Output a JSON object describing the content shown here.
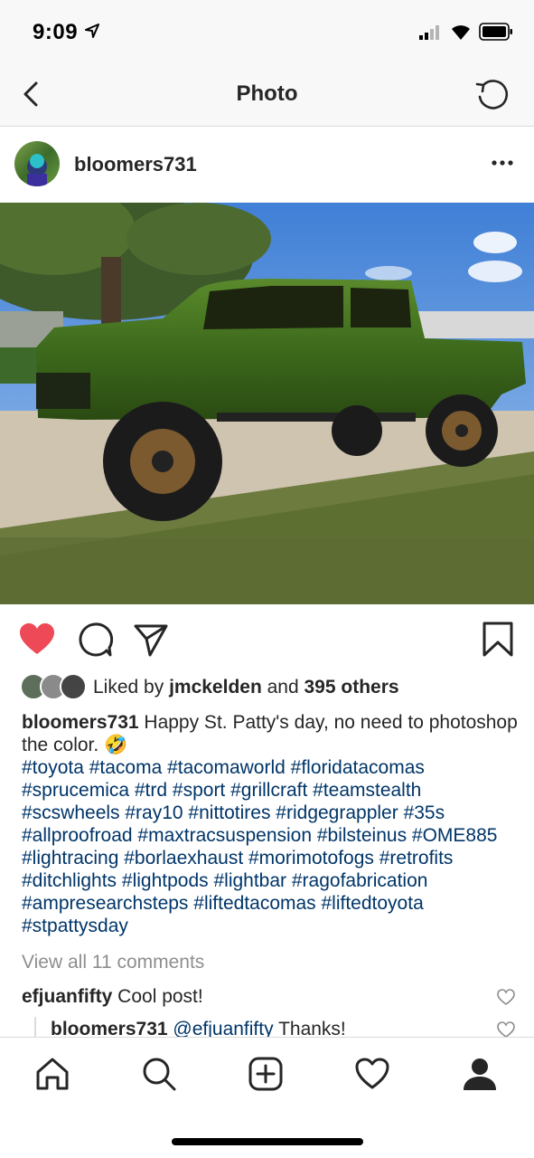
{
  "status": {
    "time": "9:09"
  },
  "nav": {
    "title": "Photo"
  },
  "post": {
    "username": "bloomers731",
    "likes": {
      "prefix": "Liked by ",
      "user": "jmckelden",
      "mid": " and ",
      "count": "395 others"
    },
    "caption_user": "bloomers731",
    "caption_text": " Happy St. Patty's day, no need to photoshop the color. 🤣",
    "hashtags": "#toyota #tacoma #tacomaworld #floridatacomas #sprucemica #trd #sport  #grillcraft #teamstealth #scswheels #ray10 #nittotires #ridgegrappler #35s #allproofroad #maxtracsuspension #bilsteinus #OME885 #lightracing #borlaexhaust #morimotofogs #retrofits #ditchlights #lightpods #lightbar #ragofabrication #ampresearchsteps #liftedtacomas #liftedtoyota #stpattysday",
    "view_all": "View all 11 comments",
    "comment": {
      "user": "efjuanfifty",
      "text": " Cool post!"
    },
    "reply": {
      "user": "bloomers731",
      "mention": " @efjuanfifty",
      "text": " Thanks!"
    }
  },
  "colors": {
    "accent_heart": "#ed4956",
    "link": "#003569",
    "muted": "#8e8e8e",
    "truck_green": "#3f6a1f"
  },
  "icons": [
    "back-icon",
    "refresh-icon",
    "more-icon",
    "heart-icon",
    "comment-icon",
    "share-icon",
    "bookmark-icon",
    "home-icon",
    "search-icon",
    "add-icon",
    "activity-icon",
    "profile-icon"
  ]
}
